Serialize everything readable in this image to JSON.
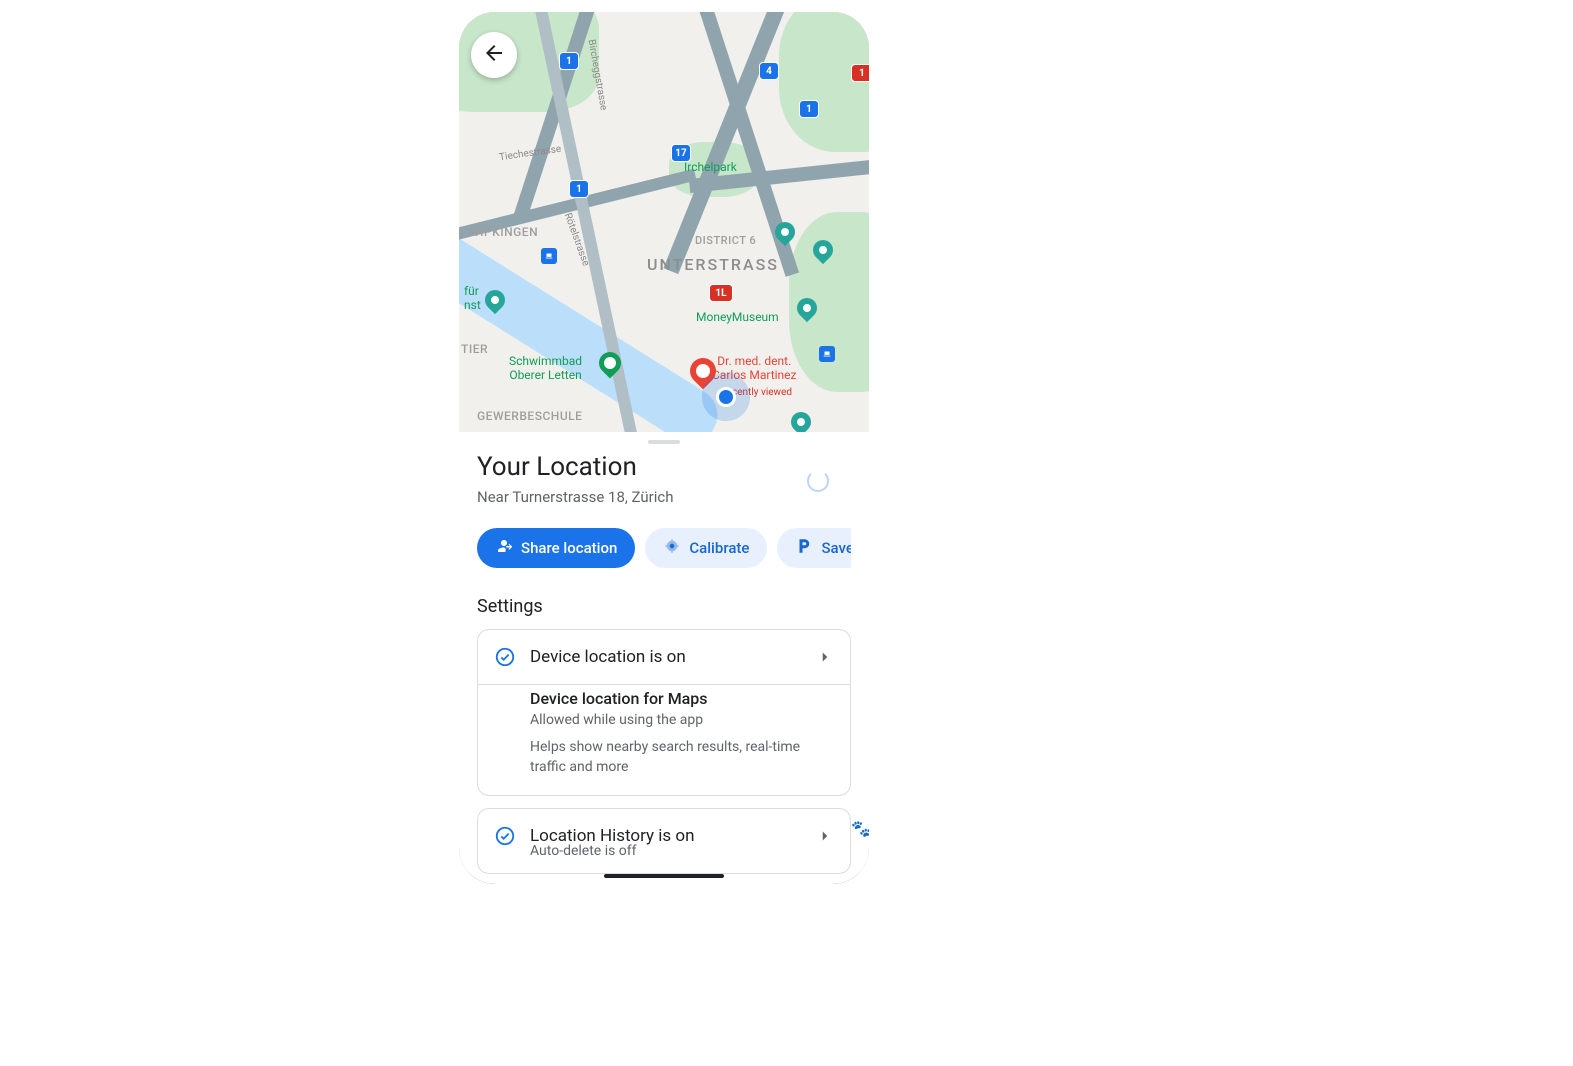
{
  "sheet": {
    "title": "Your Location",
    "subtitle": "Near Turnerstrasse 18, Zürich",
    "chips": {
      "share": "Share location",
      "calibrate": "Calibrate",
      "parking": "Save parkin"
    },
    "settings_header": "Settings",
    "card1": {
      "title": "Device location is on",
      "sub_title": "Device location for Maps",
      "sub_status": "Allowed while using the app",
      "sub_desc": "Helps show nearby search results, real-time traffic and more"
    },
    "card2": {
      "title": "Location History is on",
      "subtitle": "Auto-delete is off"
    }
  },
  "map": {
    "neighborhoods": {
      "unterstrass": "UNTERSTRASS",
      "district6": "DISTRICT 6",
      "wipkingen": "WIPKINGEN",
      "gewerbeschule": "GEWERBESCHULE",
      "tier": "TIER"
    },
    "pois": {
      "irchelpark": "Irchelpark",
      "moneymuseum": "MoneyMuseum",
      "schwimmbad": "Schwimmbad\nOberer Letten",
      "dentist": "Dr. med. dent.\nCarlos Martinez",
      "furkunst": "für\nnst"
    },
    "recently_viewed": "cently viewed",
    "roads": {
      "tiechestrasse": "Tiechestrasse",
      "bucheggstrasse": "Bircheggstrasse",
      "rotelstrasse": "Rötelstrasse"
    },
    "shields": [
      "1",
      "17",
      "4",
      "1L"
    ]
  }
}
